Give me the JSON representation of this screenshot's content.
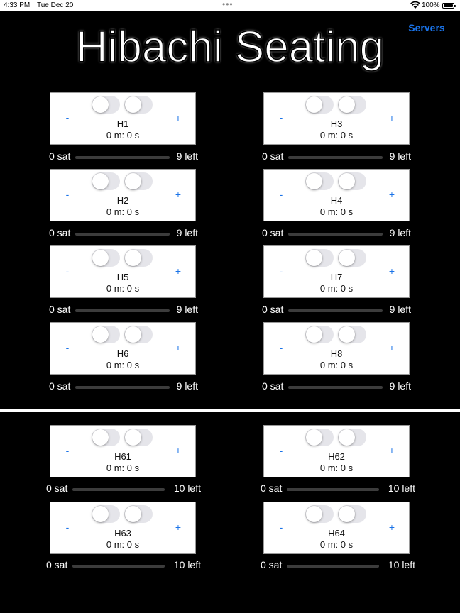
{
  "status_bar": {
    "time": "4:33 PM",
    "date": "Tue Dec 20",
    "dots": "•••",
    "battery": "100%"
  },
  "header": {
    "servers_label": "Servers",
    "title": "Hibachi Seating"
  },
  "controls": {
    "minus": "-",
    "plus": "+"
  },
  "tables": [
    {
      "name": "H1",
      "timer": "0 m: 0 s",
      "sat": "0 sat",
      "left": "9 left",
      "progress": 0
    },
    {
      "name": "H3",
      "timer": "0 m: 0 s",
      "sat": "0 sat",
      "left": "9 left",
      "progress": 0
    },
    {
      "name": "H2",
      "timer": "0 m: 0 s",
      "sat": "0 sat",
      "left": "9 left",
      "progress": 0
    },
    {
      "name": "H4",
      "timer": "0 m: 0 s",
      "sat": "0 sat",
      "left": "9 left",
      "progress": 0
    },
    {
      "name": "H5",
      "timer": "0 m: 0 s",
      "sat": "0 sat",
      "left": "9 left",
      "progress": 0
    },
    {
      "name": "H7",
      "timer": "0 m: 0 s",
      "sat": "0 sat",
      "left": "9 left",
      "progress": 0
    },
    {
      "name": "H6",
      "timer": "0 m: 0 s",
      "sat": "0 sat",
      "left": "9 left",
      "progress": 0
    },
    {
      "name": "H8",
      "timer": "0 m: 0 s",
      "sat": "0 sat",
      "left": "9 left",
      "progress": 0
    },
    {
      "name": "H61",
      "timer": "0 m: 0 s",
      "sat": "0 sat",
      "left": "10 left",
      "progress": 0
    },
    {
      "name": "H62",
      "timer": "0 m: 0 s",
      "sat": "0 sat",
      "left": "10 left",
      "progress": 0
    },
    {
      "name": "H63",
      "timer": "0 m: 0 s",
      "sat": "0 sat",
      "left": "10 left",
      "progress": 0
    },
    {
      "name": "H64",
      "timer": "0 m: 0 s",
      "sat": "0 sat",
      "left": "10 left",
      "progress": 0
    }
  ],
  "colors": {
    "accent": "#1a73e8",
    "background": "#000000",
    "card": "#ffffff"
  }
}
